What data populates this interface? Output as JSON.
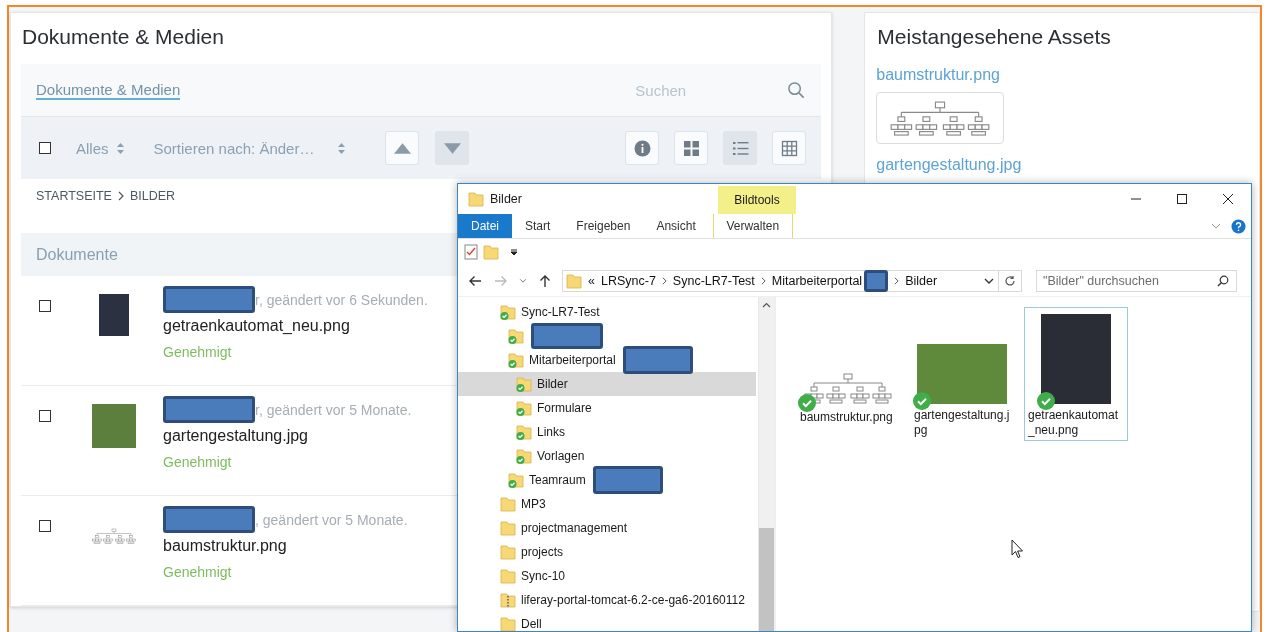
{
  "documents_panel": {
    "title": "Dokumente & Medien",
    "nav": {
      "tabs": [
        {
          "label": "Dokumente & Medien",
          "selected": true
        }
      ],
      "search": {
        "placeholder": "Suchen"
      }
    },
    "toolbar": {
      "select_all": {
        "checked": false
      },
      "filter": {
        "label": "Alles"
      },
      "sort": {
        "label": "Sortieren nach: Änder…"
      },
      "sort_buttons": [
        {
          "kind": "ascending",
          "selected": false
        },
        {
          "kind": "descending",
          "selected": true
        }
      ],
      "view_buttons": [
        {
          "kind": "info",
          "selected": false
        },
        {
          "kind": "cards",
          "selected": false
        },
        {
          "kind": "list",
          "selected": true
        },
        {
          "kind": "table",
          "selected": false
        }
      ]
    },
    "breadcrumb": [
      "STARTSEITE",
      "BILDER"
    ],
    "section": {
      "title": "Dokumente"
    },
    "rows": [
      {
        "checked": false,
        "kind": "machine",
        "author_redacted": true,
        "meta": "r, geändert vor 6 Sekunden.",
        "name": "getraenkautomat_neu.png",
        "status": "Genehmigt"
      },
      {
        "checked": false,
        "kind": "garden",
        "author_redacted": true,
        "meta": "r, geändert vor 5 Monate.",
        "name": "gartengestaltung.jpg",
        "status": "Genehmigt"
      },
      {
        "checked": false,
        "kind": "diagram",
        "author_redacted": true,
        "meta": ", geändert vor 5 Monate.",
        "name": "baumstruktur.png",
        "status": "Genehmigt"
      }
    ]
  },
  "most_viewed": {
    "title": "Meistangesehene Assets",
    "assets": [
      {
        "name": "baumstruktur.png",
        "thumbnail": true
      },
      {
        "name": "gartengestaltung.jpg",
        "thumbnail": false
      }
    ]
  },
  "explorer": {
    "title": "Bilder",
    "ribbon": {
      "context_label": "Bildtools",
      "tabs": [
        {
          "label": "Datei",
          "kind": "file",
          "selected": true
        },
        {
          "label": "Start",
          "kind": "plain",
          "selected": false
        },
        {
          "label": "Freigeben",
          "kind": "plain",
          "selected": false
        },
        {
          "label": "Ansicht",
          "kind": "plain",
          "selected": false
        },
        {
          "label": "Verwalten",
          "kind": "context",
          "selected": false
        }
      ]
    },
    "address": {
      "overflow": "«",
      "parts": [
        {
          "label": "LRSync-7",
          "redacted": false
        },
        {
          "label": "Sync-LR7-Test",
          "redacted": false
        },
        {
          "label": "Mitarbeiterportal",
          "redacted": true
        },
        {
          "label": "Bilder",
          "redacted": false
        }
      ]
    },
    "search": {
      "placeholder": "\"Bilder\" durchsuchen"
    },
    "tree": [
      {
        "label": "Sync-LR7-Test",
        "kind": "folder",
        "synced": true,
        "selected": false,
        "redacted": false,
        "children": [
          {
            "kind": "folder",
            "synced": true,
            "selected": false,
            "redacted": true
          },
          {
            "label": "Mitarbeiterportal",
            "kind": "folder",
            "synced": true,
            "selected": false,
            "redacted": true,
            "children": [
              {
                "label": "Bilder",
                "kind": "folder",
                "synced": true,
                "selected": true,
                "redacted": false
              },
              {
                "label": "Formulare",
                "kind": "folder",
                "synced": true,
                "selected": false,
                "redacted": false
              },
              {
                "label": "Links",
                "kind": "folder",
                "synced": true,
                "selected": false,
                "redacted": false
              },
              {
                "label": "Vorlagen",
                "kind": "folder",
                "synced": true,
                "selected": false,
                "redacted": false
              }
            ]
          },
          {
            "label": "Teamraum",
            "kind": "folder",
            "synced": true,
            "selected": false,
            "redacted": true
          }
        ]
      },
      {
        "label": "MP3",
        "kind": "folder",
        "synced": false,
        "selected": false,
        "redacted": false
      },
      {
        "label": "projectmanagement",
        "kind": "folder",
        "synced": false,
        "selected": false,
        "redacted": false
      },
      {
        "label": "projects",
        "kind": "folder",
        "synced": false,
        "selected": false,
        "redacted": false
      },
      {
        "label": "Sync-10",
        "kind": "folder",
        "synced": false,
        "selected": false,
        "redacted": false
      },
      {
        "label": "liferay-portal-tomcat-6.2-ce-ga6-20160112",
        "kind": "zip",
        "synced": false,
        "selected": false,
        "redacted": false
      },
      {
        "label": "Dell",
        "kind": "folder",
        "synced": false,
        "selected": false,
        "redacted": false
      }
    ],
    "files": [
      {
        "name": "baumstruktur.png",
        "kind": "diagram",
        "synced": true,
        "selected": false
      },
      {
        "name": "gartengestaltung.jpg",
        "kind": "garden",
        "synced": true,
        "selected": false
      },
      {
        "name": "getraenkautomat_neu.png",
        "kind": "machine",
        "synced": true,
        "selected": true
      }
    ]
  }
}
